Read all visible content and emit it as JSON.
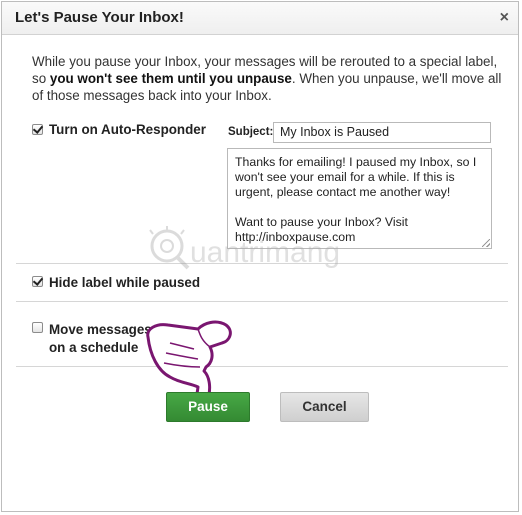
{
  "dialog": {
    "title": "Let's Pause Your Inbox!",
    "close_glyph": "×"
  },
  "intro": {
    "part1": "While you pause your Inbox, your messages will be rerouted to a special label, so ",
    "bold": "you won't see them until you unpause",
    "part2": ". When you unpause, we'll move all of those messages back into your Inbox."
  },
  "auto_responder": {
    "checked": true,
    "label": "Turn on Auto-Responder",
    "subject_label": "Subject:",
    "subject_value": "My Inbox is Paused",
    "message_line1": "Thanks for emailing! I paused my Inbox, so I won't see your email for a while. If this is urgent, please contact me another way!",
    "message_line2": "Want to pause your Inbox? Visit http://inboxpause.com"
  },
  "hide_label": {
    "checked": true,
    "label": "Hide label while paused"
  },
  "schedule": {
    "checked": false,
    "label_line1": "Move messages",
    "label_line2": "on a schedule"
  },
  "buttons": {
    "pause": "Pause",
    "cancel": "Cancel"
  },
  "watermark": {
    "text": "uantrimang"
  },
  "colors": {
    "pause_button": "#3c9a3a",
    "cancel_button": "#dcdcdc"
  }
}
